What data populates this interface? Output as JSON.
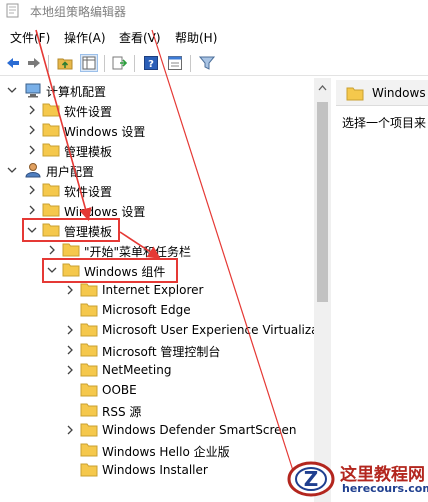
{
  "window": {
    "title": "本地组策略编辑器"
  },
  "menubar": {
    "items": [
      "文件(F)",
      "操作(A)",
      "查看(V)",
      "帮助(H)"
    ]
  },
  "toolbar": {
    "buttons": [
      "back-arrow-icon",
      "forward-arrow-icon",
      "up-folder-icon",
      "show-hide-tree-icon",
      "export-list-icon",
      "help-icon",
      "properties-icon",
      "filter-icon"
    ]
  },
  "tree": {
    "computer_config": "计算机配置",
    "cc_software": "软件设置",
    "cc_windows": "Windows 设置",
    "cc_admin": "管理模板",
    "user_config": "用户配置",
    "uc_software": "软件设置",
    "uc_windows": "Windows 设置",
    "uc_admin": "管理模板",
    "start_menu": "\"开始\"菜单和任务栏",
    "windows_components": "Windows 组件",
    "children": [
      "Internet Explorer",
      "Microsoft Edge",
      "Microsoft User Experience Virtualiza",
      "Microsoft 管理控制台",
      "NetMeeting",
      "OOBE",
      "RSS 源",
      "Windows Defender SmartScreen",
      "Windows Hello 企业版",
      "Windows Installer"
    ]
  },
  "right_pane": {
    "header": "Windows",
    "body": "选择一个项目来"
  },
  "watermark": {
    "main": "这里教程网",
    "sub": "herecours.com",
    "logo_letter": "Z"
  },
  "colors": {
    "highlight_red": "#e53935",
    "folder_yellow": "#f5c84c",
    "accent_blue": "#2b6cd3"
  }
}
